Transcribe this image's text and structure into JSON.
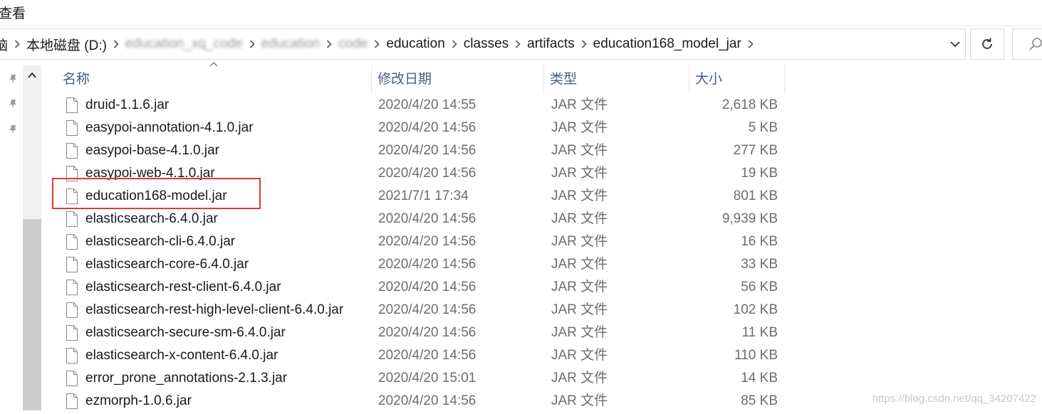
{
  "ribbon": {
    "view_tab": "查看"
  },
  "address": {
    "crumbs": [
      {
        "label": "脑",
        "blurred": false,
        "cut": true
      },
      {
        "label": "本地磁盘 (D:)",
        "blurred": false
      },
      {
        "label": "education_xq_code",
        "blurred": true
      },
      {
        "label": "education",
        "blurred": true
      },
      {
        "label": "code",
        "blurred": true
      },
      {
        "label": "education",
        "blurred": false
      },
      {
        "label": "classes",
        "blurred": false
      },
      {
        "label": "artifacts",
        "blurred": false
      },
      {
        "label": "education168_model_jar",
        "blurred": false
      }
    ]
  },
  "columns": {
    "name": "名称",
    "date": "修改日期",
    "type": "类型",
    "size": "大小"
  },
  "files": [
    {
      "name": "druid-1.1.6.jar",
      "date": "2020/4/20 14:55",
      "type": "JAR 文件",
      "size": "2,618 KB"
    },
    {
      "name": "easypoi-annotation-4.1.0.jar",
      "date": "2020/4/20 14:56",
      "type": "JAR 文件",
      "size": "5 KB"
    },
    {
      "name": "easypoi-base-4.1.0.jar",
      "date": "2020/4/20 14:56",
      "type": "JAR 文件",
      "size": "277 KB"
    },
    {
      "name": "easypoi-web-4.1.0.jar",
      "date": "2020/4/20 14:56",
      "type": "JAR 文件",
      "size": "19 KB"
    },
    {
      "name": "education168-model.jar",
      "date": "2021/7/1 17:34",
      "type": "JAR 文件",
      "size": "801 KB"
    },
    {
      "name": "elasticsearch-6.4.0.jar",
      "date": "2020/4/20 14:56",
      "type": "JAR 文件",
      "size": "9,939 KB"
    },
    {
      "name": "elasticsearch-cli-6.4.0.jar",
      "date": "2020/4/20 14:56",
      "type": "JAR 文件",
      "size": "16 KB"
    },
    {
      "name": "elasticsearch-core-6.4.0.jar",
      "date": "2020/4/20 14:56",
      "type": "JAR 文件",
      "size": "33 KB"
    },
    {
      "name": "elasticsearch-rest-client-6.4.0.jar",
      "date": "2020/4/20 14:56",
      "type": "JAR 文件",
      "size": "56 KB"
    },
    {
      "name": "elasticsearch-rest-high-level-client-6.4.0.jar",
      "date": "2020/4/20 14:56",
      "type": "JAR 文件",
      "size": "102 KB"
    },
    {
      "name": "elasticsearch-secure-sm-6.4.0.jar",
      "date": "2020/4/20 14:56",
      "type": "JAR 文件",
      "size": "11 KB"
    },
    {
      "name": "elasticsearch-x-content-6.4.0.jar",
      "date": "2020/4/20 14:56",
      "type": "JAR 文件",
      "size": "110 KB"
    },
    {
      "name": "error_prone_annotations-2.1.3.jar",
      "date": "2020/4/20 15:01",
      "type": "JAR 文件",
      "size": "14 KB"
    },
    {
      "name": "ezmorph-1.0.6.jar",
      "date": "2020/4/20 14:56",
      "type": "JAR 文件",
      "size": "85 KB"
    }
  ],
  "annotation": {
    "highlight_color": "#e53935",
    "highlighted_file_index": 4
  },
  "watermark": "https://blog.csdn.net/qq_34207422",
  "colors": {
    "header_text": "#4c607a",
    "secondary_text": "#6d6d6d",
    "scroll_thumb": "#cdcdcd"
  }
}
